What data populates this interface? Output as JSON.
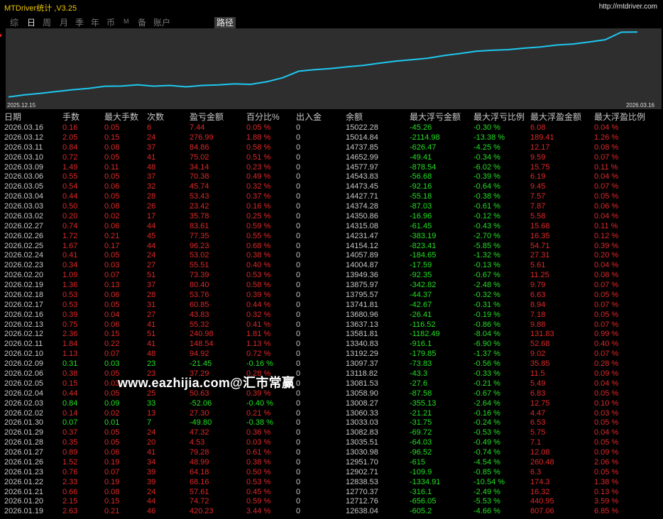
{
  "app": {
    "title": "MTDriver统计 ,V3.25",
    "link": "http://mtdriver.com"
  },
  "tabs": [
    {
      "label": "综",
      "active": false
    },
    {
      "label": "日",
      "active": true
    },
    {
      "label": "周",
      "active": false
    },
    {
      "label": "月",
      "active": false
    },
    {
      "label": "季",
      "active": false
    },
    {
      "label": "年",
      "active": false
    },
    {
      "label": "币",
      "active": false
    },
    {
      "label": "M",
      "active": false
    },
    {
      "label": "备",
      "active": false
    },
    {
      "label": "账户",
      "active": false
    }
  ],
  "path_tab": "路径",
  "chart_data": {
    "type": "line",
    "x_start_label": "2025.12.15",
    "x_end_label": "2026.03.16",
    "line_color": "#1ec8f0",
    "background": "#2e2e2e",
    "x": [
      "2026.01.19",
      "2026.01.20",
      "2026.01.21",
      "2026.01.22",
      "2026.01.23",
      "2026.01.26",
      "2026.01.27",
      "2026.01.28",
      "2026.01.29",
      "2026.01.30",
      "2026.02.02",
      "2026.02.03",
      "2026.02.04",
      "2026.02.05",
      "2026.02.06",
      "2026.02.09",
      "2026.02.10",
      "2026.02.11",
      "2026.02.12",
      "2026.02.13",
      "2026.02.16",
      "2026.02.17",
      "2026.02.18",
      "2026.02.19",
      "2026.02.20",
      "2026.02.23",
      "2026.02.24",
      "2026.02.25",
      "2026.02.26",
      "2026.02.27",
      "2026.03.02",
      "2026.03.03",
      "2026.03.04",
      "2026.03.05",
      "2026.03.06",
      "2026.03.09",
      "2026.03.10",
      "2026.03.11",
      "2026.03.12",
      "2026.03.16"
    ],
    "values": [
      12638.04,
      12712.76,
      12770.37,
      12838.53,
      12902.71,
      12951.7,
      13030.98,
      13035.51,
      13082.83,
      13033.03,
      13060.33,
      13008.27,
      13058.9,
      13081.53,
      13118.82,
      13097.37,
      13192.29,
      13340.83,
      13581.81,
      13637.13,
      13680.96,
      13741.81,
      13795.57,
      13875.97,
      13949.36,
      14004.87,
      14057.89,
      14154.12,
      14231.47,
      14315.08,
      14350.86,
      14374.28,
      14427.71,
      14473.45,
      14543.83,
      14577.97,
      14652.99,
      14737.85,
      15014.84,
      15022.28
    ]
  },
  "table": {
    "headers": [
      "日期",
      "手数",
      "最大手数",
      "次数",
      "盈亏金额",
      "百分比%",
      "出入金",
      "余额",
      "最大浮亏金额",
      "最大浮亏比例",
      "最大浮盈金额",
      "最大浮盈比例"
    ],
    "rows": [
      [
        "2026.03.16",
        "0.16",
        "0.05",
        "6",
        "7.44",
        "0.05 %",
        "0",
        "15022.28",
        "-45.26",
        "-0.30 %",
        "6.08",
        "0.04 %"
      ],
      [
        "2026.03.12",
        "2.05",
        "0.15",
        "24",
        "276.99",
        "1.88 %",
        "0",
        "15014.84",
        "-2114.98",
        "-13.38 %",
        "189.41",
        "1.26 %"
      ],
      [
        "2026.03.11",
        "0.84",
        "0.08",
        "37",
        "84.86",
        "0.58 %",
        "0",
        "14737.85",
        "-626.47",
        "-4.25 %",
        "12.17",
        "0.08 %"
      ],
      [
        "2026.03.10",
        "0.72",
        "0.05",
        "41",
        "75.02",
        "0.51 %",
        "0",
        "14652.99",
        "-49.41",
        "-0.34 %",
        "9.59",
        "0.07 %"
      ],
      [
        "2026.03.09",
        "1.49",
        "0.11",
        "48",
        "34.14",
        "0.23 %",
        "0",
        "14577.97",
        "-878.54",
        "-6.02 %",
        "15.75",
        "0.11 %"
      ],
      [
        "2026.03.06",
        "0.55",
        "0.05",
        "37",
        "70.38",
        "0.49 %",
        "0",
        "14543.83",
        "-56.68",
        "-0.39 %",
        "6.19",
        "0.04 %"
      ],
      [
        "2026.03.05",
        "0.54",
        "0.06",
        "32",
        "45.74",
        "0.32 %",
        "0",
        "14473.45",
        "-92.16",
        "-0.64 %",
        "9.45",
        "0.07 %"
      ],
      [
        "2026.03.04",
        "0.44",
        "0.05",
        "28",
        "53.43",
        "0.37 %",
        "0",
        "14427.71",
        "-55.18",
        "-0.38 %",
        "7.57",
        "0.05 %"
      ],
      [
        "2026.03.03",
        "0.50",
        "0.08",
        "26",
        "23.42",
        "0.16 %",
        "0",
        "14374.28",
        "-87.03",
        "-0.61 %",
        "7.87",
        "0.06 %"
      ],
      [
        "2026.03.02",
        "0.20",
        "0.02",
        "17",
        "35.78",
        "0.25 %",
        "0",
        "14350.86",
        "-16.96",
        "-0.12 %",
        "5.58",
        "0.04 %"
      ],
      [
        "2026.02.27",
        "0.74",
        "0.06",
        "44",
        "83.61",
        "0.59 %",
        "0",
        "14315.08",
        "-61.45",
        "-0.43 %",
        "15.68",
        "0.11 %"
      ],
      [
        "2026.02.26",
        "1.72",
        "0.21",
        "45",
        "77.35",
        "0.55 %",
        "0",
        "14231.47",
        "-383.19",
        "-2.70 %",
        "16.35",
        "0.12 %"
      ],
      [
        "2026.02.25",
        "1.67",
        "0.17",
        "44",
        "96.23",
        "0.68 %",
        "0",
        "14154.12",
        "-823.41",
        "-5.85 %",
        "54.71",
        "0.39 %"
      ],
      [
        "2026.02.24",
        "0.41",
        "0.05",
        "24",
        "53.02",
        "0.38 %",
        "0",
        "14057.89",
        "-184.65",
        "-1.32 %",
        "27.31",
        "0.20 %"
      ],
      [
        "2026.02.23",
        "0.34",
        "0.03",
        "27",
        "55.51",
        "0.40 %",
        "0",
        "14004.87",
        "-17.59",
        "-0.13 %",
        "5.61",
        "0.04 %"
      ],
      [
        "2026.02.20",
        "1.09",
        "0.07",
        "51",
        "73.39",
        "0.53 %",
        "0",
        "13949.36",
        "-92.35",
        "-0.67 %",
        "11.25",
        "0.08 %"
      ],
      [
        "2026.02.19",
        "1.36",
        "0.13",
        "37",
        "80.40",
        "0.58 %",
        "0",
        "13875.97",
        "-342.82",
        "-2.48 %",
        "9.79",
        "0.07 %"
      ],
      [
        "2026.02.18",
        "0.53",
        "0.06",
        "28",
        "53.76",
        "0.39 %",
        "0",
        "13795.57",
        "-44.37",
        "-0.32 %",
        "6.63",
        "0.05 %"
      ],
      [
        "2026.02.17",
        "0.53",
        "0.05",
        "31",
        "60.85",
        "0.44 %",
        "0",
        "13741.81",
        "-42.67",
        "-0.31 %",
        "8.94",
        "0.07 %"
      ],
      [
        "2026.02.16",
        "0.39",
        "0.04",
        "27",
        "43.83",
        "0.32 %",
        "0",
        "13680.96",
        "-26.41",
        "-0.19 %",
        "7.18",
        "0.05 %"
      ],
      [
        "2026.02.13",
        "0.75",
        "0.06",
        "41",
        "55.32",
        "0.41 %",
        "0",
        "13637.13",
        "-116.52",
        "-0.86 %",
        "9.88",
        "0.07 %"
      ],
      [
        "2026.02.12",
        "2.36",
        "0.15",
        "51",
        "240.98",
        "1.81 %",
        "0",
        "13581.81",
        "-1182.49",
        "-8.04 %",
        "131.83",
        "0.99 %"
      ],
      [
        "2026.02.11",
        "1.84",
        "0.22",
        "41",
        "148.54",
        "1.13 %",
        "0",
        "13340.83",
        "-916.1",
        "-6.90 %",
        "52.68",
        "0.40 %"
      ],
      [
        "2026.02.10",
        "1.13",
        "0.07",
        "48",
        "94.92",
        "0.72 %",
        "0",
        "13192.29",
        "-179.85",
        "-1.37 %",
        "9.02",
        "0.07 %"
      ],
      [
        "2026.02.09",
        "0.31",
        "0.03",
        "23",
        "-21.45",
        "-0.16 %",
        "0",
        "13097.37",
        "-73.83",
        "-0.56 %",
        "35.85",
        "0.28 %"
      ],
      [
        "2026.02.06",
        "0.38",
        "0.05",
        "23",
        "37.29",
        "0.28 %",
        "0",
        "13118.82",
        "-43.3",
        "-0.33 %",
        "11.5",
        "0.09 %"
      ],
      [
        "2026.02.05",
        "0.15",
        "0.03",
        "",
        "",
        "",
        "0",
        "13081.53",
        "-27.6",
        "-0.21 %",
        "5.49",
        "0.04 %"
      ],
      [
        "2026.02.04",
        "0.44",
        "0.05",
        "25",
        "50.63",
        "0.39 %",
        "0",
        "13058.90",
        "-87.58",
        "-0.67 %",
        "6.83",
        "0.05 %"
      ],
      [
        "2026.02.03",
        "0.84",
        "0.09",
        "33",
        "-52.06",
        "-0.40 %",
        "0",
        "13008.27",
        "-355.13",
        "-2.64 %",
        "12.75",
        "0.10 %"
      ],
      [
        "2026.02.02",
        "0.14",
        "0.02",
        "13",
        "27.30",
        "0.21 %",
        "0",
        "13060.33",
        "-21.21",
        "-0.16 %",
        "4.47",
        "0.03 %"
      ],
      [
        "2026.01.30",
        "0.07",
        "0.01",
        "7",
        "-49.80",
        "-0.38 %",
        "0",
        "13033.03",
        "-31.75",
        "-0.24 %",
        "6.53",
        "0.05 %"
      ],
      [
        "2026.01.29",
        "0.37",
        "0.05",
        "24",
        "47.32",
        "0.36 %",
        "0",
        "13082.83",
        "-69.72",
        "-0.53 %",
        "5.75",
        "0.04 %"
      ],
      [
        "2026.01.28",
        "0.35",
        "0.05",
        "20",
        "4.53",
        "0.03 %",
        "0",
        "13035.51",
        "-64.03",
        "-0.49 %",
        "7.1",
        "0.05 %"
      ],
      [
        "2026.01.27",
        "0.89",
        "0.06",
        "41",
        "79.28",
        "0.61 %",
        "0",
        "13030.98",
        "-96.52",
        "-0.74 %",
        "12.08",
        "0.09 %"
      ],
      [
        "2026.01.26",
        "1.52",
        "0.19",
        "34",
        "48.99",
        "0.38 %",
        "0",
        "12951.70",
        "-615",
        "-4.54 %",
        "260.48",
        "2.06 %"
      ],
      [
        "2026.01.23",
        "0.76",
        "0.07",
        "39",
        "64.18",
        "0.50 %",
        "0",
        "12902.71",
        "-109.9",
        "-0.85 %",
        "6.3",
        "0.05 %"
      ],
      [
        "2026.01.22",
        "2.33",
        "0.19",
        "39",
        "68.16",
        "0.53 %",
        "0",
        "12838.53",
        "-1334.91",
        "-10.54 %",
        "174.3",
        "1.38 %"
      ],
      [
        "2026.01.21",
        "0.66",
        "0.08",
        "24",
        "57.61",
        "0.45 %",
        "0",
        "12770.37",
        "-316.1",
        "-2.49 %",
        "16.32",
        "0.13 %"
      ],
      [
        "2026.01.20",
        "2.15",
        "0.15",
        "44",
        "74.72",
        "0.59 %",
        "0",
        "12712.76",
        "-656.05",
        "-5.53 %",
        "440.95",
        "3.59 %"
      ],
      [
        "2026.01.19",
        "2.63",
        "0.21",
        "46",
        "420.23",
        "3.44 %",
        "0",
        "12638.04",
        "-605.2",
        "-4.66 %",
        "807.06",
        "6.85 %"
      ]
    ]
  },
  "watermark": "www.eazhijia.com@汇市常赢"
}
